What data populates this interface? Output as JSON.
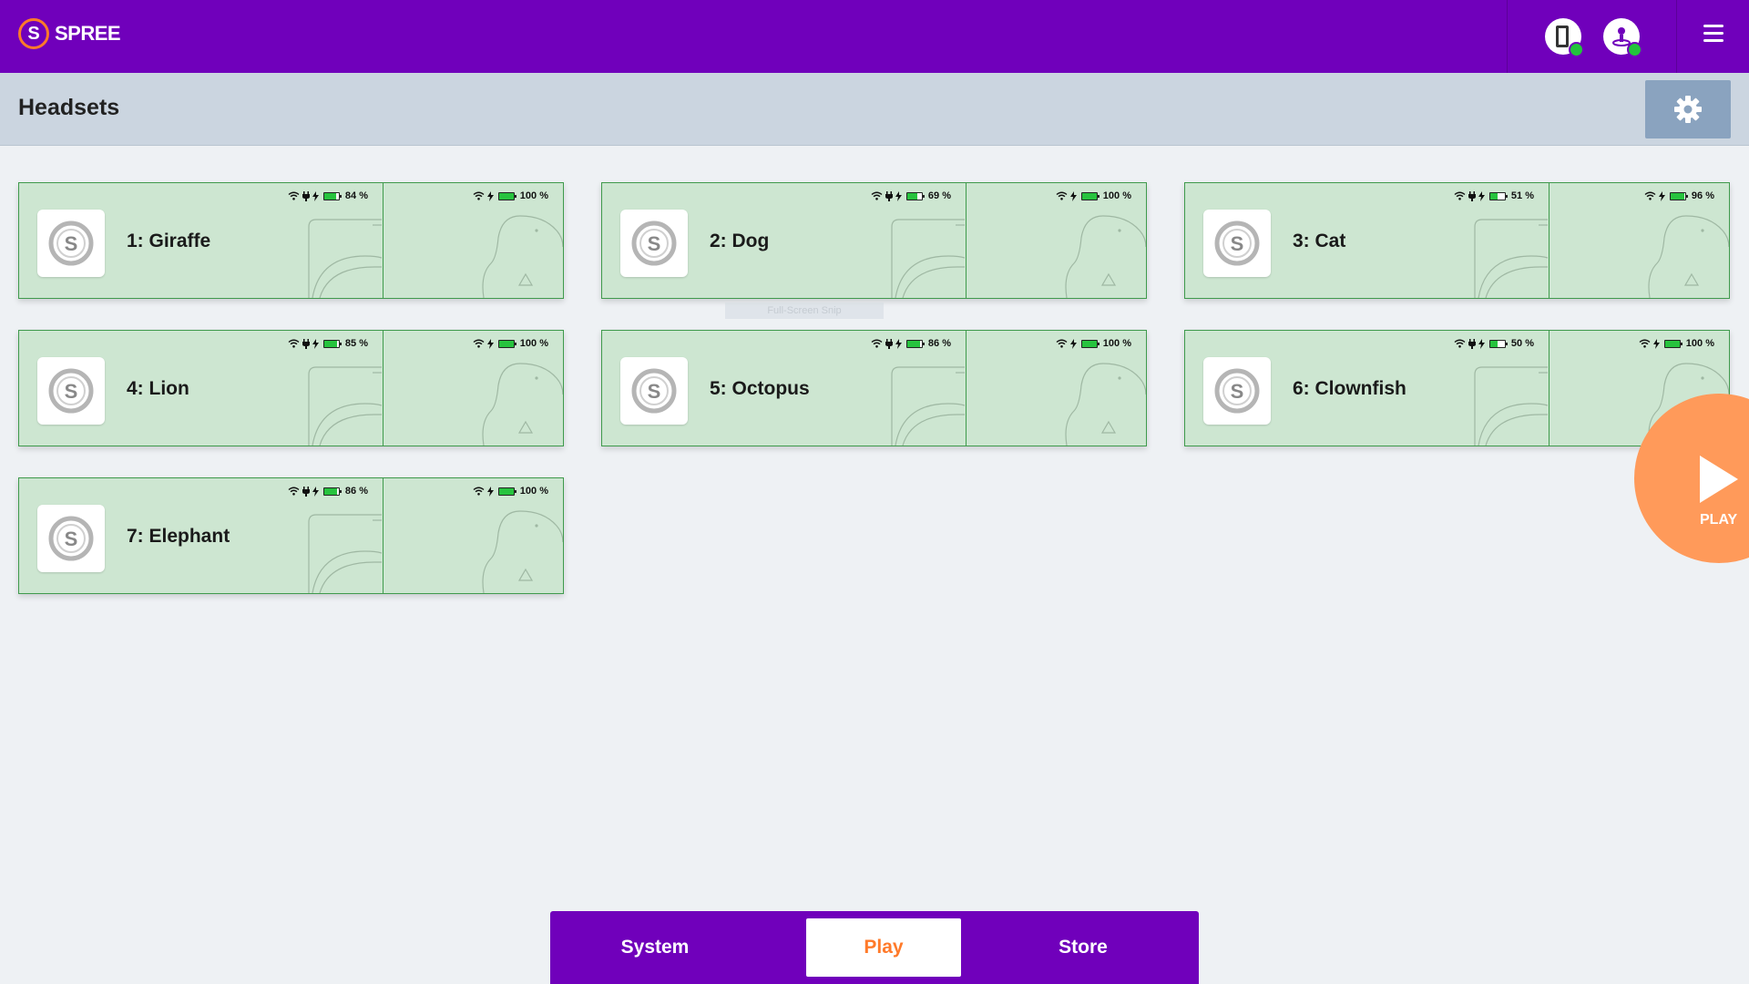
{
  "app": {
    "brand": "SPREE",
    "logo_letter": "S"
  },
  "header": {
    "title": "Headsets"
  },
  "icons": {
    "status_left": "headset-tracker-icon",
    "status_right": "operator-icon",
    "menu": "hamburger-menu-icon",
    "settings": "gear-icon",
    "wifi": "wifi-icon",
    "plug": "plug-icon",
    "bolt": "charging-bolt-icon",
    "battery": "battery-icon"
  },
  "colors": {
    "brand_purple": "#7000bb",
    "accent_orange": "#ff7a2a",
    "card_bg": "#cde6d1",
    "card_border": "#3f9a4c",
    "status_online": "#22c33c"
  },
  "headsets": [
    {
      "name": "1: Giraffe",
      "headset_battery": "84 %",
      "headset_level": 84,
      "controller_battery": "100 %",
      "controller_level": 100
    },
    {
      "name": "2: Dog",
      "headset_battery": "69 %",
      "headset_level": 69,
      "controller_battery": "100 %",
      "controller_level": 100
    },
    {
      "name": "3: Cat",
      "headset_battery": "51 %",
      "headset_level": 51,
      "controller_battery": "96 %",
      "controller_level": 96
    },
    {
      "name": "4: Lion",
      "headset_battery": "85 %",
      "headset_level": 85,
      "controller_battery": "100 %",
      "controller_level": 100
    },
    {
      "name": "5: Octopus",
      "headset_battery": "86 %",
      "headset_level": 86,
      "controller_battery": "100 %",
      "controller_level": 100
    },
    {
      "name": "6: Clownfish",
      "headset_battery": "50 %",
      "headset_level": 50,
      "controller_battery": "100 %",
      "controller_level": 100
    },
    {
      "name": "7: Elephant",
      "headset_battery": "86 %",
      "headset_level": 86,
      "controller_battery": "100 %",
      "controller_level": 100
    }
  ],
  "ghost_text": "Full-Screen Snip",
  "play_button": {
    "label": "PLAY"
  },
  "bottom_nav": {
    "items": [
      {
        "label": "System",
        "active": false
      },
      {
        "label": "Play",
        "active": true
      },
      {
        "label": "Store",
        "active": false
      }
    ]
  }
}
